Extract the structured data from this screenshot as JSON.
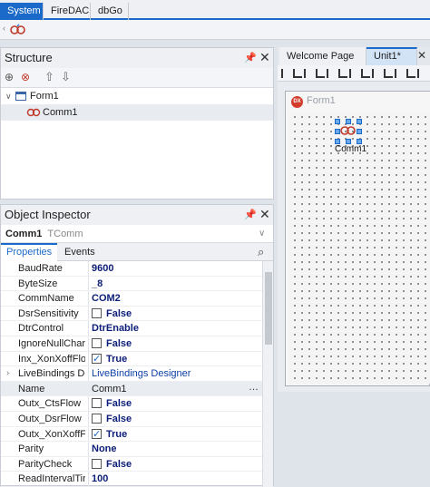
{
  "palette": {
    "tabs": [
      "System",
      "FireDAC",
      "dbGo"
    ],
    "active_tab": "System",
    "component_icon": "comm-component-icon"
  },
  "structure": {
    "title": "Structure",
    "tree": [
      {
        "label": "Form1",
        "icon": "form-icon",
        "level": 0
      },
      {
        "label": "Comm1",
        "icon": "comm-component-icon",
        "level": 1
      }
    ]
  },
  "inspector": {
    "title": "Object Inspector",
    "selected_name": "Comm1",
    "selected_type": "TComm",
    "tabs": [
      "Properties",
      "Events"
    ],
    "active_tab": "Properties",
    "properties": [
      {
        "name": "BaudRate",
        "value": "9600",
        "kind": "bold"
      },
      {
        "name": "ByteSize",
        "value": "_8",
        "kind": "bold"
      },
      {
        "name": "CommName",
        "value": "COM2",
        "kind": "bold"
      },
      {
        "name": "DsrSensitivity",
        "value": "False",
        "kind": "check",
        "checked": false
      },
      {
        "name": "DtrControl",
        "value": "DtrEnable",
        "kind": "bold"
      },
      {
        "name": "IgnoreNullChar",
        "value": "False",
        "kind": "check",
        "checked": false
      },
      {
        "name": "Inx_XonXoffFlow",
        "value": "True",
        "kind": "check",
        "checked": true
      },
      {
        "name": "LiveBindings Designer",
        "value": "LiveBindings Designer",
        "kind": "link",
        "expandable": true
      },
      {
        "name": "Name",
        "value": "Comm1",
        "kind": "normal",
        "selected": true
      },
      {
        "name": "Outx_CtsFlow",
        "value": "False",
        "kind": "check",
        "checked": false
      },
      {
        "name": "Outx_DsrFlow",
        "value": "False",
        "kind": "check",
        "checked": false
      },
      {
        "name": "Outx_XonXoffFlow",
        "value": "True",
        "kind": "check",
        "checked": true
      },
      {
        "name": "Parity",
        "value": "None",
        "kind": "bold"
      },
      {
        "name": "ParityCheck",
        "value": "False",
        "kind": "check",
        "checked": false
      },
      {
        "name": "ReadIntervalTimeout",
        "value": "100",
        "kind": "bold"
      }
    ]
  },
  "designer": {
    "tabs": [
      "Welcome Page",
      "Unit1*"
    ],
    "active_tab": "Unit1*",
    "form_caption": "Form1",
    "form_badge": "DX",
    "component_label": "Comm1"
  },
  "colors": {
    "accent": "#1b6ac9",
    "selection": "#e9ecf1"
  }
}
